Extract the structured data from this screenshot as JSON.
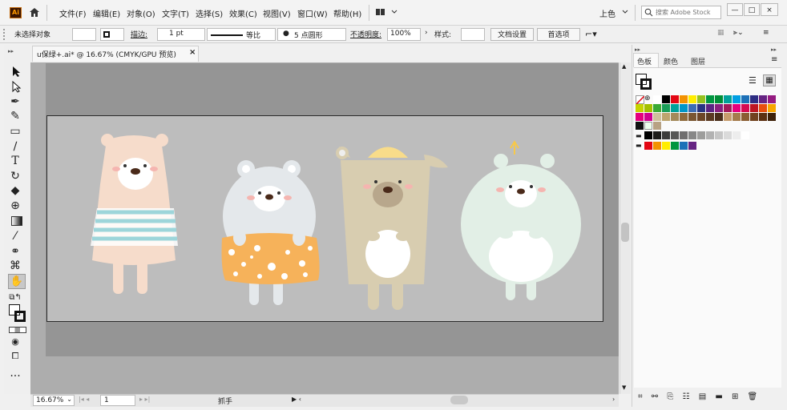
{
  "app": {
    "logo": "Ai"
  },
  "menu": [
    "文件(F)",
    "编辑(E)",
    "对象(O)",
    "文字(T)",
    "选择(S)",
    "效果(C)",
    "视图(V)",
    "窗口(W)",
    "帮助(H)"
  ],
  "workspace": "上色",
  "search": {
    "placeholder": "搜索 Adobe Stock"
  },
  "control": {
    "selection": "未选择对象",
    "stroke_label": "描边:",
    "stroke_value": "1 pt",
    "profile": "等比",
    "brush": "5 点圆形",
    "opacity_label": "不透明度:",
    "opacity_value": "100%",
    "style_label": "样式:",
    "doc_settings": "文档设置",
    "preferences": "首选项"
  },
  "document": {
    "tab_title": "u保绿+.ai* @ 16.67% (CMYK/GPU 预览)",
    "close": "×"
  },
  "status": {
    "zoom": "16.67%",
    "page": "1",
    "tool": "抓手"
  },
  "panel": {
    "tabs": [
      "色板",
      "颜色",
      "图层"
    ],
    "rows": [
      [
        "#ffffff",
        "#000000",
        "#e30613",
        "#f39200",
        "#ffed00",
        "#95c11f",
        "#009640",
        "#008d36",
        "#00a19a",
        "#009fe3",
        "#1d71b8",
        "#2d2e83",
        "#662483",
        "#951b81",
        "#e6007e",
        "#e71d73"
      ],
      [
        "#c7d300",
        "#a3c000",
        "#3aaa35",
        "#1a9e58",
        "#00a19a",
        "#0096c8",
        "#3c6db5",
        "#283583",
        "#5c2483",
        "#8a1f7f",
        "#a3195b",
        "#e6007e",
        "#d60b52",
        "#be1622",
        "#e84e0f",
        "#f7a600"
      ],
      [
        "#e5007e",
        "#d0008f",
        "#cfc09c",
        "#bda56f",
        "#a48a5b",
        "#8f6b3d",
        "#7a5632",
        "#6d4627",
        "#5b3a22",
        "#4a2e1a",
        "#c69c6d",
        "#a57b4c",
        "#8b5e34",
        "#71431f",
        "#5c3112",
        "#3e2109"
      ]
    ],
    "gray_row": [
      "#000000",
      "#1d1d1b",
      "#3c3c3b",
      "#575756",
      "#706f6f",
      "#878787",
      "#9d9d9c",
      "#b2b2b2",
      "#c6c6c6",
      "#dadada",
      "#ededed",
      "#ffffff"
    ],
    "bright_row": [
      "#e30613",
      "#f39200",
      "#ffed00",
      "#009640",
      "#1d71b8",
      "#662483"
    ]
  },
  "tools": [
    "selection-tool",
    "direct-selection-tool",
    "pen-tool",
    "curvature-tool",
    "rectangle-tool",
    "paintbrush-tool",
    "pencil-tool",
    "type-tool",
    "rotate-tool",
    "eraser-tool",
    "shape-builder-tool",
    "gradient-tool",
    "eyedropper-tool",
    "blend-tool",
    "symbol-sprayer-tool",
    "hand-tool"
  ]
}
